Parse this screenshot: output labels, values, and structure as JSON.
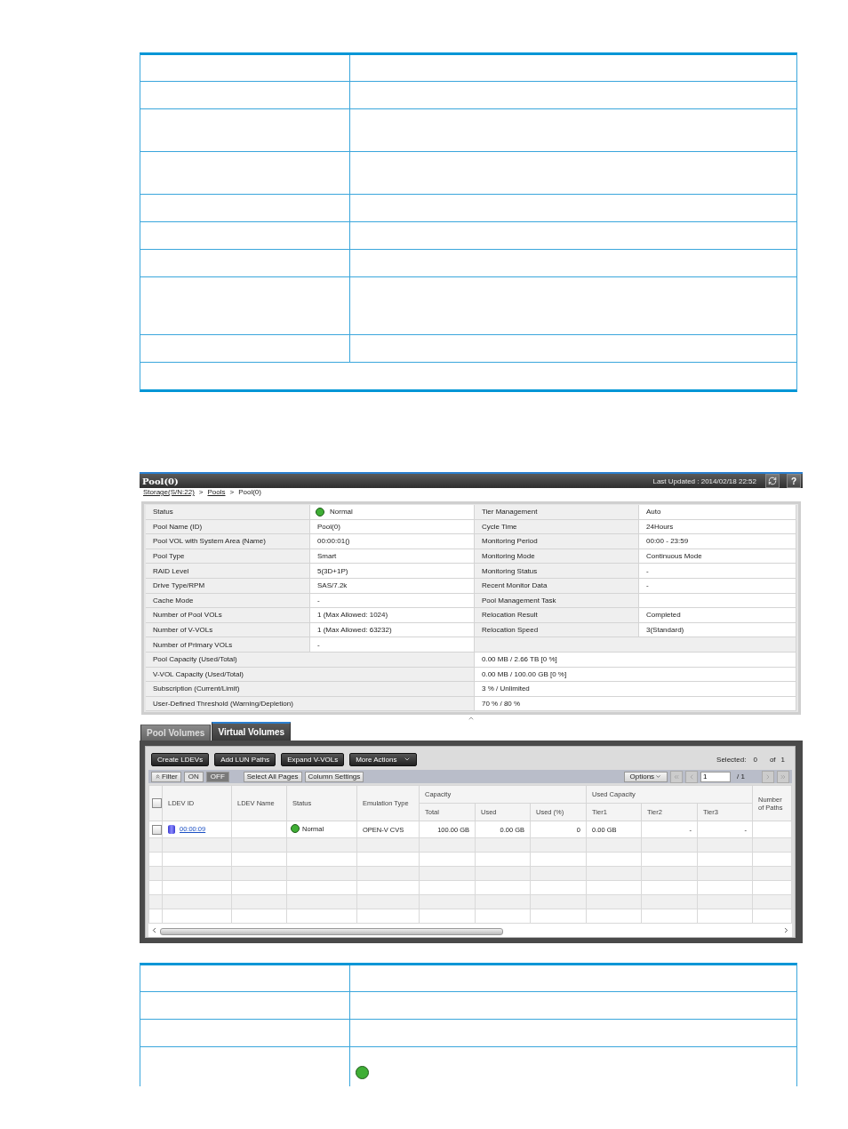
{
  "doc_table_top": {
    "rows": [
      {
        "kind": "header"
      },
      {
        "kind": "single"
      },
      {
        "kind": "double"
      },
      {
        "kind": "double"
      },
      {
        "kind": "single"
      },
      {
        "kind": "single"
      },
      {
        "kind": "single"
      },
      {
        "kind": "triple"
      },
      {
        "kind": "single"
      },
      {
        "kind": "full"
      }
    ]
  },
  "panel": {
    "title": "Pool(0)",
    "last_updated": "Last Updated : 2014/02/18 22:52",
    "help_label": "?",
    "breadcrumb": [
      {
        "label": "Storage(S/N:22)",
        "link": true
      },
      {
        "label": ">",
        "link": false
      },
      {
        "label": "Pools",
        "link": true
      },
      {
        "label": ">",
        "link": false
      },
      {
        "label": "Pool(0)",
        "link": false
      }
    ],
    "summary": [
      {
        "kind": "pair",
        "label": "Status",
        "value": "Normal",
        "color": "#3fae35",
        "label2": "Tier Management",
        "value2": "Auto"
      },
      {
        "kind": "pair",
        "label": "Pool Name (ID)",
        "value": "Pool(0)",
        "label2": "Cycle Time",
        "value2": "24Hours"
      },
      {
        "kind": "pair",
        "label": "Pool VOL with System Area (Name)",
        "value": "00:00:01()",
        "label2": "Monitoring Period",
        "value2": "00:00 - 23:59"
      },
      {
        "kind": "pair",
        "label": "Pool Type",
        "value": "Smart",
        "label2": "Monitoring Mode",
        "value2": "Continuous Mode"
      },
      {
        "kind": "pair",
        "label": "RAID Level",
        "value": "5(3D+1P)",
        "label2": "Monitoring Status",
        "value2": "-"
      },
      {
        "kind": "pair",
        "label": "Drive Type/RPM",
        "value": "SAS/7.2k",
        "label2": "Recent Monitor Data",
        "value2": "-"
      },
      {
        "kind": "pair",
        "label": "Cache Mode",
        "value": "-",
        "label2": "Pool Management Task"
      },
      {
        "kind": "pair",
        "label": "Number of Pool VOLs",
        "value": "1 (Max Allowed: 1024)",
        "label2": "Relocation Result",
        "value2": "Completed"
      },
      {
        "kind": "pair",
        "label": "Number of V-VOLs",
        "value": "1 (Max Allowed: 63232)",
        "label2": "Relocation Speed",
        "value2": "3(Standard)"
      },
      {
        "kind": "single",
        "label": "Number of Primary VOLs",
        "value": "-"
      },
      {
        "kind": "wide",
        "label": "Pool Capacity (Used/Total)",
        "value": "0.00 MB / 2.66 TB [0 %]"
      },
      {
        "kind": "wide",
        "label": "V-VOL Capacity (Used/Total)",
        "value": "0.00 MB / 100.00 GB [0 %]"
      },
      {
        "kind": "wide",
        "label": "Subscription (Current/Limit)",
        "value": "3 % / Unlimited"
      },
      {
        "kind": "wide",
        "label": "User-Defined Threshold (Warning/Depletion)",
        "value": "70 % / 80 %"
      }
    ],
    "tabs": [
      {
        "label": "Pool Volumes",
        "selected": false
      },
      {
        "label": "Virtual Volumes",
        "selected": true
      }
    ],
    "actions": [
      "Create LDEVs",
      "Add LUN Paths",
      "Expand V-VOLs"
    ],
    "more_actions": "More Actions",
    "selected": {
      "label": "Selected:",
      "count": "0",
      "of": "of",
      "total": "1"
    },
    "filter": {
      "label": "Filter",
      "options": [
        {
          "label": "ON",
          "selected": false
        },
        {
          "label": "OFF",
          "selected": true
        }
      ]
    },
    "filter_buttons": [
      "Select All Pages",
      "Column Settings"
    ],
    "options_label": "Options",
    "pager": {
      "page": "1",
      "total": "/ 1"
    },
    "table": {
      "header_checked": false,
      "columns": [
        {
          "label": "LDEV ID"
        },
        {
          "label": "LDEV Name"
        },
        {
          "label": "Status"
        },
        {
          "label": "Emulation Type"
        },
        {
          "label": "Capacity",
          "children": [
            "Total",
            "Used",
            "Used (%)"
          ]
        },
        {
          "label": "Used Capacity",
          "children": [
            "Tier1",
            "Tier2",
            "Tier3"
          ]
        },
        {
          "label": "Number of Paths"
        }
      ],
      "rows": [
        {
          "checked": false,
          "ldev_id": "00:00:09",
          "status": "Normal",
          "color": "#3fae35",
          "emulation": "OPEN-V CVS",
          "total": "100.00 GB",
          "used": "0.00 GB",
          "used_pct": "0",
          "tier1": "0.00 GB",
          "tier2": "-",
          "tier3": "-"
        }
      ]
    }
  },
  "doc_table_bottom": {
    "rows": [
      {
        "kind": "header"
      },
      {
        "kind": "single"
      },
      {
        "kind": "single"
      },
      {
        "kind": "status",
        "color": "#3fae35"
      }
    ]
  }
}
